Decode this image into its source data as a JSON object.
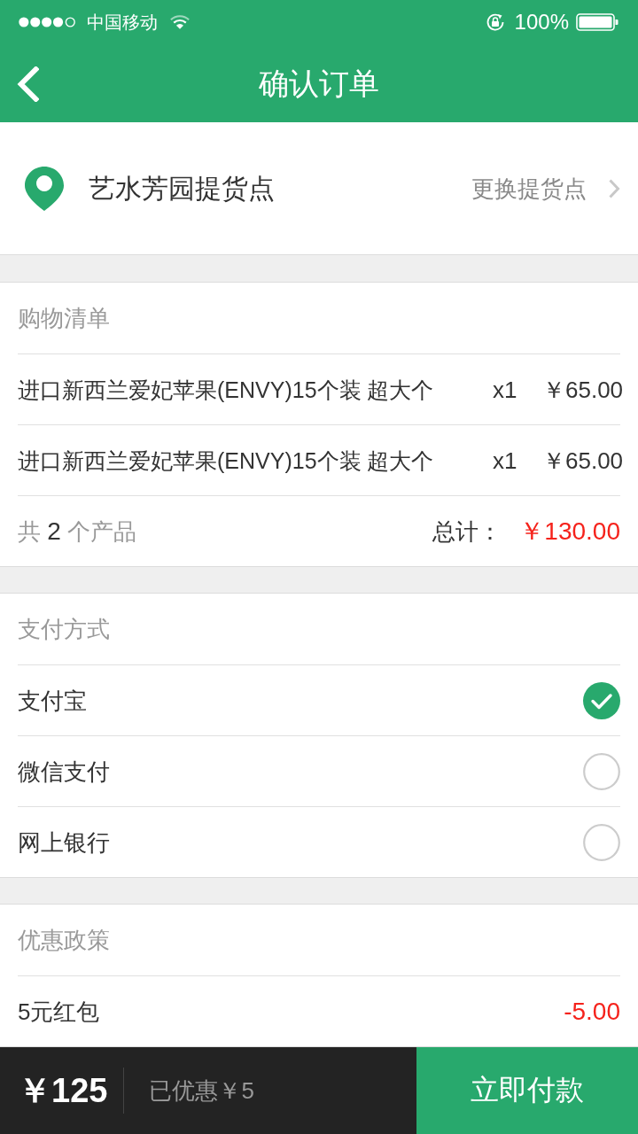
{
  "status_bar": {
    "carrier": "中国移动",
    "battery": "100%"
  },
  "nav_bar": {
    "title": "确认订单"
  },
  "pickup": {
    "name": "艺水芳园提货点",
    "action": "更换提货点"
  },
  "shopping_list": {
    "title": "购物清单",
    "items": [
      {
        "name": "进口新西兰爱妃苹果(ENVY)15个装 超大个",
        "quantity": "x1",
        "price": "￥65.00"
      },
      {
        "name": "进口新西兰爱妃苹果(ENVY)15个装 超大个",
        "quantity": "x1",
        "price": "￥65.00"
      }
    ],
    "summary": {
      "count_prefix": "共",
      "count": "2",
      "count_suffix": "个产品",
      "total_label": "总计：",
      "total": "￥130.00"
    }
  },
  "payment": {
    "title": "支付方式",
    "options": [
      {
        "label": "支付宝",
        "selected": true
      },
      {
        "label": "微信支付",
        "selected": false
      },
      {
        "label": "网上银行",
        "selected": false
      }
    ]
  },
  "discounts": {
    "title": "优惠政策",
    "items": [
      {
        "label": "5元红包",
        "amount": "-5.00"
      }
    ]
  },
  "bottom_bar": {
    "total": "￥125",
    "saved": "已优惠￥5",
    "pay_button": "立即付款"
  }
}
